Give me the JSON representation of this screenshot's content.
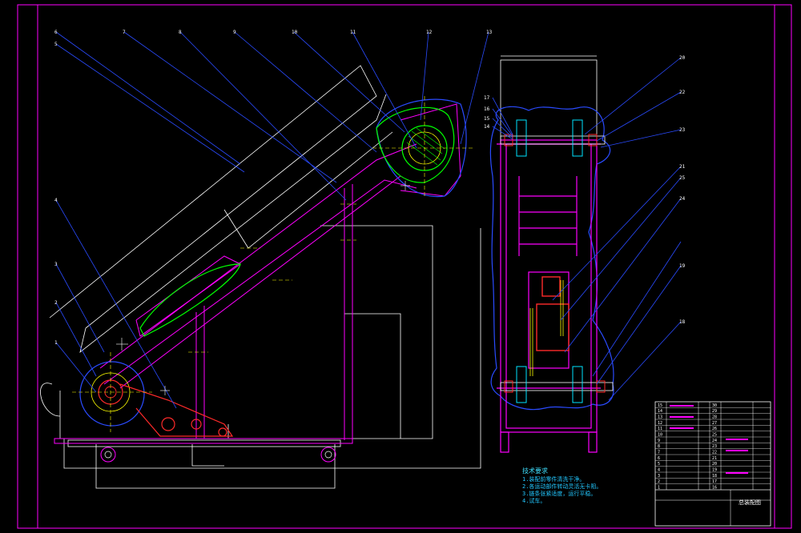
{
  "colors": {
    "background": "#000000",
    "frame": "#ff00ff",
    "leader": "#0000ff",
    "outline": "#ffffff",
    "green": "#00ff00",
    "red": "#ff2a2a",
    "yellow": "#ffff00",
    "cyan": "#00e5ff",
    "blue": "#2a4bff"
  },
  "balloons_left": [
    "6",
    "7",
    "8",
    "9",
    "10",
    "11",
    "12",
    "13",
    "5",
    "4",
    "3",
    "2",
    "1"
  ],
  "balloons_right": [
    "17",
    "16",
    "15",
    "14",
    "20",
    "22",
    "23",
    "21",
    "25",
    "24",
    "19",
    "18"
  ],
  "tech_notes": {
    "title": "技术要求",
    "lines": [
      "1.装配前零件清洗干净。",
      "2.各运动部件转动灵活无卡阻。",
      "3.链条张紧适度，运行平稳。",
      "4.试车。"
    ]
  },
  "title_block": {
    "rows": [
      "15",
      "14",
      "13",
      "12",
      "11",
      "10",
      "9",
      "8",
      "7",
      "6",
      "5",
      "4",
      "3",
      "2",
      "1"
    ],
    "rows_right": [
      "30",
      "29",
      "28",
      "27",
      "26",
      "25",
      "24",
      "23",
      "22",
      "21",
      "20",
      "19",
      "18",
      "17",
      "16"
    ],
    "drawing_title": "总装配图"
  }
}
